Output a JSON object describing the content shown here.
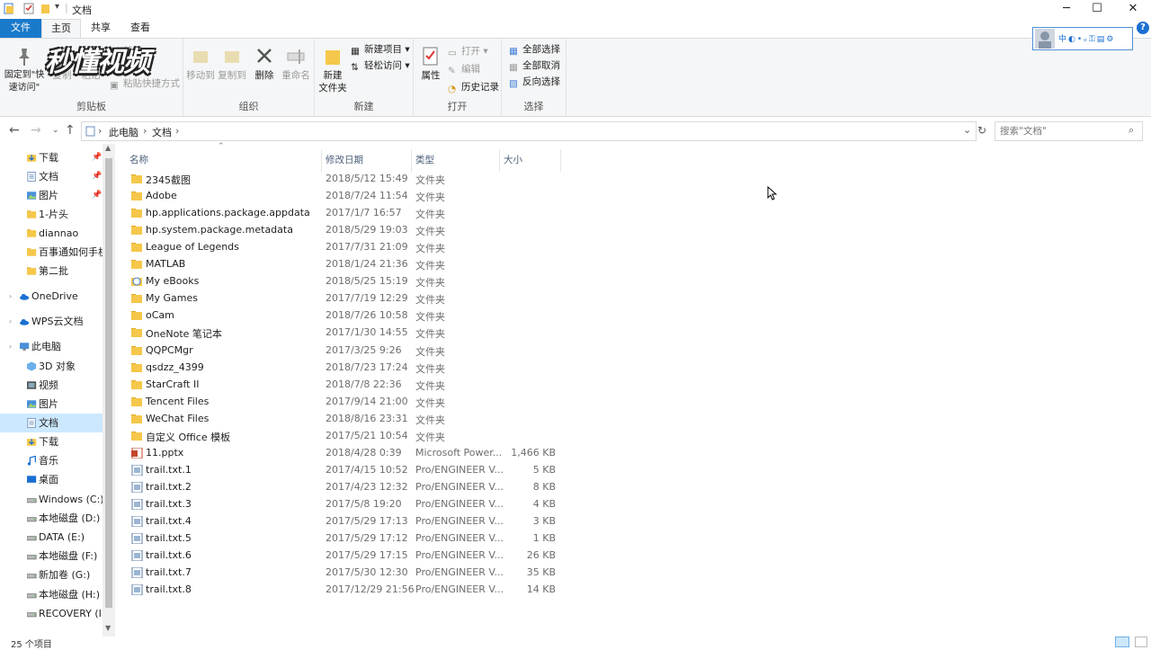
{
  "window": {
    "title": "文档",
    "minimize": "─",
    "maximize": "☐",
    "close": "✕"
  },
  "tabs": {
    "file": "文件",
    "home": "主页",
    "share": "共享",
    "view": "查看"
  },
  "ribbon": {
    "clipboard": {
      "label": "剪贴板",
      "pin": "固定到\"快速访问\"",
      "copy": "复制",
      "paste": "粘贴",
      "cut": "剪切",
      "paste_shortcut": "粘贴快捷方式"
    },
    "organize": {
      "label": "组织",
      "move_to": "移动到",
      "copy_to": "复制到",
      "delete": "删除",
      "rename": "重命名"
    },
    "new": {
      "label": "新建",
      "new_folder": "新建\n文件夹",
      "new_item": "新建项目",
      "easy_access": "轻松访问"
    },
    "open": {
      "label": "打开",
      "properties": "属性",
      "open": "打开",
      "edit": "编辑",
      "history": "历史记录"
    },
    "select": {
      "label": "选择",
      "select_all": "全部选择",
      "select_none": "全部取消",
      "invert": "反向选择"
    }
  },
  "watermark": "秒懂视频",
  "ime": [
    "中",
    "◐",
    "•ₒ",
    "⚿",
    "▤",
    "⚙"
  ],
  "help": "?",
  "address": {
    "root": "此电脑",
    "current": "文档"
  },
  "search": {
    "placeholder": "搜索\"文档\""
  },
  "nav": [
    {
      "label": "下载",
      "icon": "download-icon",
      "pinned": true
    },
    {
      "label": "文档",
      "icon": "document-icon",
      "pinned": true
    },
    {
      "label": "图片",
      "icon": "picture-icon",
      "pinned": true
    },
    {
      "label": "1-片头",
      "icon": "folder-icon"
    },
    {
      "label": "diannao",
      "icon": "folder-icon"
    },
    {
      "label": "百事通如何手机",
      "icon": "folder-icon"
    },
    {
      "label": "第二批",
      "icon": "folder-icon"
    },
    {
      "label": "OneDrive",
      "icon": "cloud-icon"
    },
    {
      "label": "WPS云文档",
      "icon": "cloud-icon"
    },
    {
      "label": "此电脑",
      "icon": "computer-icon"
    },
    {
      "label": "3D 对象",
      "icon": "cube-icon"
    },
    {
      "label": "视频",
      "icon": "video-icon"
    },
    {
      "label": "图片",
      "icon": "picture-icon"
    },
    {
      "label": "文档",
      "icon": "document-icon",
      "selected": true
    },
    {
      "label": "下载",
      "icon": "download-icon"
    },
    {
      "label": "音乐",
      "icon": "music-icon"
    },
    {
      "label": "桌面",
      "icon": "desktop-icon"
    },
    {
      "label": "Windows (C:)",
      "icon": "drive-icon"
    },
    {
      "label": "本地磁盘 (D:)",
      "icon": "drive-icon"
    },
    {
      "label": "DATA (E:)",
      "icon": "drive-icon"
    },
    {
      "label": "本地磁盘 (F:)",
      "icon": "drive-icon"
    },
    {
      "label": "新加卷 (G:)",
      "icon": "drive-icon"
    },
    {
      "label": "本地磁盘 (H:)",
      "icon": "drive-icon"
    },
    {
      "label": "RECOVERY (I:)",
      "icon": "drive-icon"
    }
  ],
  "columns": {
    "name": "名称",
    "date": "修改日期",
    "type": "类型",
    "size": "大小"
  },
  "files": [
    {
      "name": "2345截图",
      "date": "2018/5/12 15:49",
      "type": "文件夹",
      "size": "",
      "icon": "folder-icon"
    },
    {
      "name": "Adobe",
      "date": "2018/7/24 11:54",
      "type": "文件夹",
      "size": "",
      "icon": "folder-icon"
    },
    {
      "name": "hp.applications.package.appdata",
      "date": "2017/1/7 16:57",
      "type": "文件夹",
      "size": "",
      "icon": "folder-icon"
    },
    {
      "name": "hp.system.package.metadata",
      "date": "2018/5/29 19:03",
      "type": "文件夹",
      "size": "",
      "icon": "folder-icon"
    },
    {
      "name": "League of Legends",
      "date": "2017/7/31 21:09",
      "type": "文件夹",
      "size": "",
      "icon": "folder-icon"
    },
    {
      "name": "MATLAB",
      "date": "2018/1/24 21:36",
      "type": "文件夹",
      "size": "",
      "icon": "folder-icon"
    },
    {
      "name": "My eBooks",
      "date": "2018/5/25 15:19",
      "type": "文件夹",
      "size": "",
      "icon": "ebook-folder-icon"
    },
    {
      "name": "My Games",
      "date": "2017/7/19 12:29",
      "type": "文件夹",
      "size": "",
      "icon": "folder-icon"
    },
    {
      "name": "oCam",
      "date": "2018/7/26 10:58",
      "type": "文件夹",
      "size": "",
      "icon": "folder-icon"
    },
    {
      "name": "OneNote 笔记本",
      "date": "2017/1/30 14:55",
      "type": "文件夹",
      "size": "",
      "icon": "folder-icon"
    },
    {
      "name": "QQPCMgr",
      "date": "2017/3/25 9:26",
      "type": "文件夹",
      "size": "",
      "icon": "folder-icon"
    },
    {
      "name": "qsdzz_4399",
      "date": "2018/7/23 17:24",
      "type": "文件夹",
      "size": "",
      "icon": "folder-icon"
    },
    {
      "name": "StarCraft II",
      "date": "2018/7/8 22:36",
      "type": "文件夹",
      "size": "",
      "icon": "folder-icon"
    },
    {
      "name": "Tencent Files",
      "date": "2017/9/14 21:00",
      "type": "文件夹",
      "size": "",
      "icon": "folder-icon"
    },
    {
      "name": "WeChat Files",
      "date": "2018/8/16 23:31",
      "type": "文件夹",
      "size": "",
      "icon": "folder-icon"
    },
    {
      "name": "自定义 Office 模板",
      "date": "2017/5/21 10:54",
      "type": "文件夹",
      "size": "",
      "icon": "folder-icon"
    },
    {
      "name": "11.pptx",
      "date": "2018/4/28 0:39",
      "type": "Microsoft Power...",
      "size": "1,466 KB",
      "icon": "pptx-icon"
    },
    {
      "name": "trail.txt.1",
      "date": "2017/4/15 10:52",
      "type": "Pro/ENGINEER V...",
      "size": "5 KB",
      "icon": "file-icon"
    },
    {
      "name": "trail.txt.2",
      "date": "2017/4/23 12:32",
      "type": "Pro/ENGINEER V...",
      "size": "8 KB",
      "icon": "file-icon"
    },
    {
      "name": "trail.txt.3",
      "date": "2017/5/8 19:20",
      "type": "Pro/ENGINEER V...",
      "size": "4 KB",
      "icon": "file-icon"
    },
    {
      "name": "trail.txt.4",
      "date": "2017/5/29 17:13",
      "type": "Pro/ENGINEER V...",
      "size": "3 KB",
      "icon": "file-icon"
    },
    {
      "name": "trail.txt.5",
      "date": "2017/5/29 17:12",
      "type": "Pro/ENGINEER V...",
      "size": "1 KB",
      "icon": "file-icon"
    },
    {
      "name": "trail.txt.6",
      "date": "2017/5/29 17:15",
      "type": "Pro/ENGINEER V...",
      "size": "26 KB",
      "icon": "file-icon"
    },
    {
      "name": "trail.txt.7",
      "date": "2017/5/30 12:30",
      "type": "Pro/ENGINEER V...",
      "size": "35 KB",
      "icon": "file-icon"
    },
    {
      "name": "trail.txt.8",
      "date": "2017/12/29 21:56",
      "type": "Pro/ENGINEER V...",
      "size": "14 KB",
      "icon": "file-icon"
    }
  ],
  "status": {
    "count": "25 个项目"
  },
  "colors": {
    "accent": "#1979ca",
    "selected": "#cce8ff",
    "folder": "#f5c74a"
  }
}
